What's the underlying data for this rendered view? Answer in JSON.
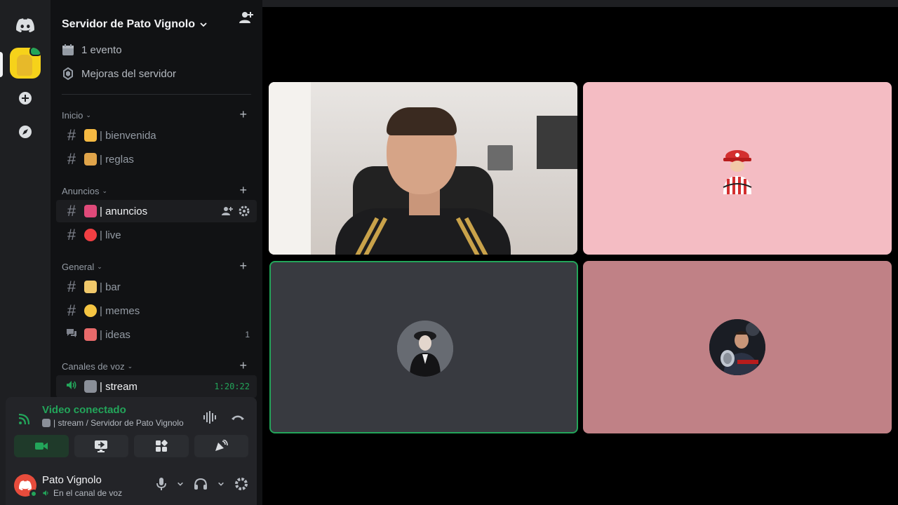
{
  "server": {
    "name": "Servidor de Pato Vignolo",
    "events": "1 evento",
    "boosts": "Mejoras del servidor"
  },
  "categories": [
    {
      "label": "Inicio",
      "channels": [
        {
          "emoji_color": "#f5b942",
          "name": "| bienvenida"
        },
        {
          "emoji_color": "#e0a44a",
          "name": "| reglas"
        }
      ]
    },
    {
      "label": "Anuncios",
      "channels": [
        {
          "emoji_color": "#e04a7a",
          "name": "| anuncios"
        },
        {
          "emoji_color": "#f23f43",
          "name": "| live"
        }
      ]
    },
    {
      "label": "General",
      "channels": [
        {
          "emoji_color": "#f0c86a",
          "name": "| bar"
        },
        {
          "emoji_color": "#f5c542",
          "name": "| memes"
        },
        {
          "emoji_color": "#e86a6a",
          "name": "| ideas",
          "badge": "1"
        }
      ]
    },
    {
      "label": "Canales de voz",
      "channels": [
        {
          "emoji_color": "#8a8f98",
          "name": "| stream",
          "timer": "1:20:22"
        }
      ]
    }
  ],
  "voice": {
    "status": "Video conectado",
    "location": "| stream / Servidor de Pato Vignolo"
  },
  "user": {
    "name": "Pato Vignolo",
    "status": "En el canal de voz"
  },
  "colors": {
    "accent_green": "#23a55a",
    "sidebar_bg": "#111214",
    "rail_bg": "#1e1f22",
    "tile_pink": "#f4bcc3",
    "tile_rose": "#c08186",
    "tile_gray": "#383a40"
  },
  "icons": {
    "rail": [
      "discord-icon",
      "add-server-icon",
      "explore-icon"
    ],
    "voice_actions": [
      "camera-icon",
      "screen-share-icon",
      "activities-icon",
      "soundboard-icon"
    ],
    "user_controls": [
      "microphone-icon",
      "headphones-icon",
      "gear-icon"
    ]
  }
}
